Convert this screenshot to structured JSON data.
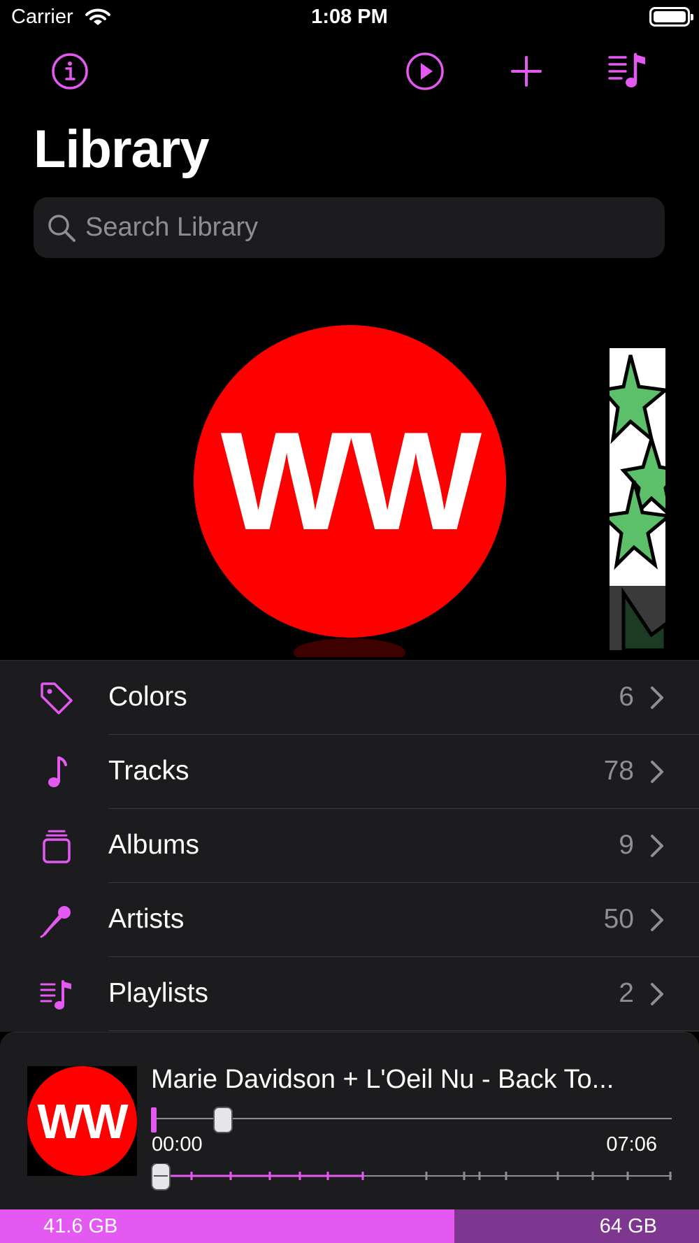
{
  "status_bar": {
    "carrier": "Carrier",
    "time": "1:08 PM"
  },
  "nav": {
    "icons": [
      "info-icon",
      "play-circle-icon",
      "plus-icon",
      "music-queue-icon"
    ],
    "accent_color": "#e459f2"
  },
  "header": {
    "title": "Library"
  },
  "search": {
    "placeholder": "Search Library",
    "value": ""
  },
  "carousel": {
    "main_art_text": "WW",
    "main_art_color": "#ff0000",
    "side_art_color": "#5cbf6a"
  },
  "library_items": [
    {
      "label": "Colors",
      "count": "6",
      "icon": "tag-icon"
    },
    {
      "label": "Tracks",
      "count": "78",
      "icon": "music-note-icon"
    },
    {
      "label": "Albums",
      "count": "9",
      "icon": "albums-stack-icon"
    },
    {
      "label": "Artists",
      "count": "50",
      "icon": "microphone-icon"
    },
    {
      "label": "Playlists",
      "count": "2",
      "icon": "playlist-icon"
    }
  ],
  "player": {
    "art_text": "WW",
    "title": "Marie Davidson + L'Oeil Nu - Back To...",
    "elapsed": "00:00",
    "duration": "07:06",
    "progress_fraction": 0.0
  },
  "storage": {
    "used": "41.6 GB",
    "total": "64 GB",
    "used_fraction": 0.65,
    "used_color": "#e459f2",
    "total_color": "#7d3790"
  }
}
